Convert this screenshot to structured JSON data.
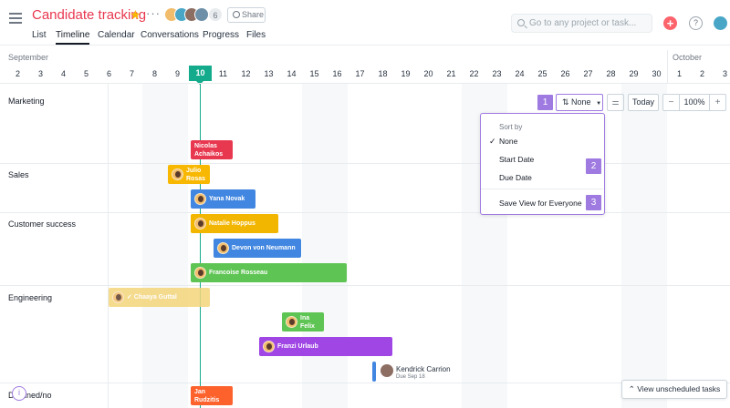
{
  "project": {
    "title": "Candidate tracking",
    "member_count": "6",
    "share_label": "Share"
  },
  "tabs": [
    {
      "label": "List"
    },
    {
      "label": "Timeline"
    },
    {
      "label": "Calendar"
    },
    {
      "label": "Conversations"
    },
    {
      "label": "Progress"
    },
    {
      "label": "Files"
    }
  ],
  "search": {
    "placeholder": "Go to any project or task..."
  },
  "help_label": "?",
  "timeline": {
    "months": [
      {
        "label": "September"
      },
      {
        "label": "October"
      }
    ],
    "days": [
      "2",
      "3",
      "4",
      "5",
      "6",
      "7",
      "8",
      "9",
      "10",
      "11",
      "12",
      "13",
      "14",
      "15",
      "16",
      "17",
      "18",
      "19",
      "20",
      "21",
      "22",
      "23",
      "24",
      "25",
      "26",
      "27",
      "28",
      "29",
      "30",
      "1",
      "2",
      "3"
    ],
    "today": "10"
  },
  "sections": [
    {
      "label": "Marketing"
    },
    {
      "label": "Sales"
    },
    {
      "label": "Customer success"
    },
    {
      "label": "Engineering"
    },
    {
      "label": "Declined/no"
    }
  ],
  "tasks": [
    {
      "name": "Nicolas\nAchaikos",
      "color": "#e8384f",
      "has_avatar": false
    },
    {
      "name": "Julio\nRosas",
      "color": "#f8b700",
      "has_avatar": true
    },
    {
      "name": "Yana Novak",
      "color": "#4186e0",
      "has_avatar": true
    },
    {
      "name": "Natalie Hoppus",
      "color": "#f2b500",
      "has_avatar": true
    },
    {
      "name": "Devon von Neumann",
      "color": "#4186e0",
      "has_avatar": true
    },
    {
      "name": "Francoise Rosseau",
      "color": "#5ec453",
      "has_avatar": true
    },
    {
      "name": "✓ Chaaya Guttal",
      "color": "#f4d57b",
      "has_avatar": true
    },
    {
      "name": "Ina\nFelix",
      "color": "#5ec453",
      "has_avatar": true
    },
    {
      "name": "Franzi Urlaub",
      "color": "#9f46e4",
      "has_avatar": true
    },
    {
      "name": "Jan\nRudzitis",
      "color": "#fd612c",
      "has_avatar": false
    }
  ],
  "milestone": {
    "name": "Kendrick Carrion",
    "due": "Due Sep 18"
  },
  "toolbar": {
    "sort_label": "None",
    "today_label": "Today",
    "zoom": "100%",
    "zoom_minus": "−",
    "zoom_plus": "+"
  },
  "sort_menu": {
    "header": "Sort by",
    "options": [
      {
        "label": "None",
        "selected": true
      },
      {
        "label": "Start Date"
      },
      {
        "label": "Due Date"
      }
    ],
    "save_label": "Save View for Everyone"
  },
  "badges": [
    "1",
    "2",
    "3"
  ],
  "unscheduled_label": "View unscheduled tasks",
  "accent_color": "#9f7ae1",
  "today_color": "#14aa8c"
}
